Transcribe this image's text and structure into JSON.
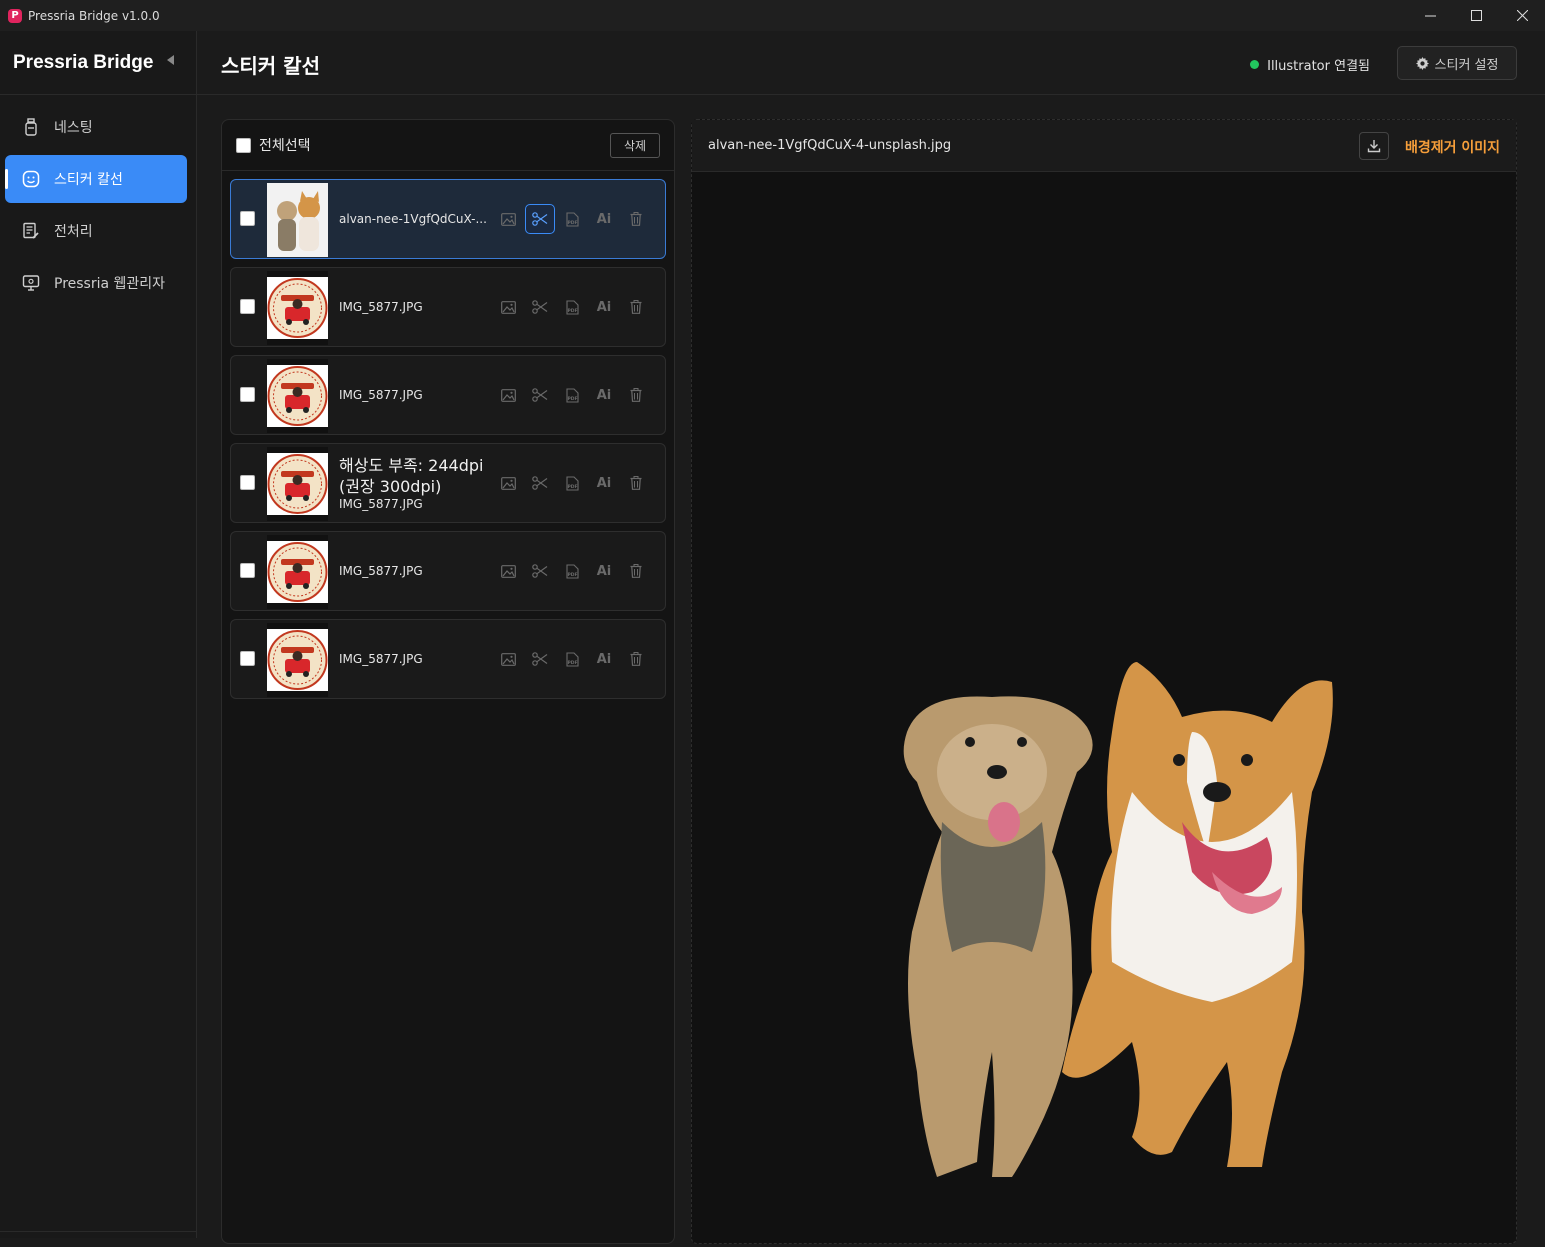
{
  "window": {
    "title": "Pressria Bridge v1.0.0",
    "logo_letter": "P"
  },
  "sidebar": {
    "brand": "Pressria Bridge",
    "items": [
      {
        "label": "네스팅",
        "icon": "bottle-icon",
        "active": false
      },
      {
        "label": "스티커 칼선",
        "icon": "sticker-icon",
        "active": true
      },
      {
        "label": "전처리",
        "icon": "document-edit-icon",
        "active": false
      },
      {
        "label": "Pressria 웹관리자",
        "icon": "monitor-icon",
        "active": false
      }
    ]
  },
  "header": {
    "title": "스티커 칼선",
    "status_text": "Illustrator 연결됨",
    "status_color": "#22c55e",
    "settings_label": "스티커 설정"
  },
  "list": {
    "select_all_label": "전체선택",
    "delete_label": "삭제",
    "action_ai_label": "Ai",
    "rows": [
      {
        "filename": "alvan-nee-1VgfQdCuX-...",
        "warning": "",
        "warning2": "",
        "thumb": "dogs"
      },
      {
        "filename": "IMG_5877.JPG",
        "warning": "",
        "warning2": "",
        "thumb": "badge"
      },
      {
        "filename": "IMG_5877.JPG",
        "warning": "",
        "warning2": "",
        "thumb": "badge"
      },
      {
        "filename": "IMG_5877.JPG",
        "warning": "해상도 부족: 244dpi",
        "warning2": "(권장 300dpi)",
        "thumb": "badge"
      },
      {
        "filename": "IMG_5877.JPG",
        "warning": "",
        "warning2": "",
        "thumb": "badge"
      },
      {
        "filename": "IMG_5877.JPG",
        "warning": "",
        "warning2": "",
        "thumb": "badge"
      }
    ]
  },
  "preview": {
    "filename": "alvan-nee-1VgfQdCuX-4-unsplash.jpg",
    "mode_label": "배경제거 이미지",
    "mode_color": "#f59e3a"
  }
}
